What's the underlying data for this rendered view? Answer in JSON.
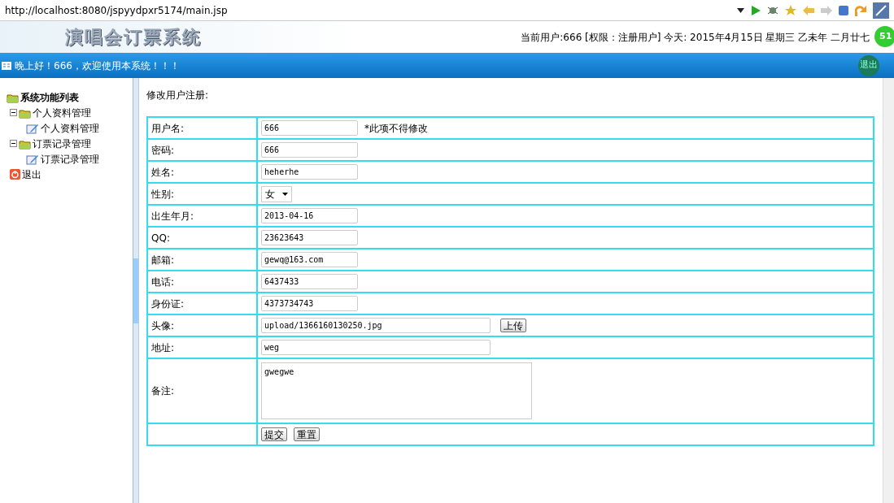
{
  "browser": {
    "url": "http://localhost:8080/jspyydpxr5174/main.jsp"
  },
  "header": {
    "title": "演唱会订票系统",
    "user_info": "当前用户:666 [权限：注册用户] 今天:  2015年4月15日 星期三 乙未年 二月廿七",
    "badge": "51"
  },
  "welcome_bar": {
    "greeting": "晚上好！666，欢迎使用本系统！！！",
    "logout": "退出"
  },
  "sidebar": {
    "title": "系统功能列表",
    "items": [
      {
        "label": "个人资料管理",
        "kind": "folder",
        "expanded": true,
        "children": [
          {
            "label": "个人资料管理",
            "kind": "page"
          }
        ]
      },
      {
        "label": "订票记录管理",
        "kind": "folder",
        "expanded": true,
        "children": [
          {
            "label": "订票记录管理",
            "kind": "page"
          }
        ]
      },
      {
        "label": "退出",
        "kind": "exit"
      }
    ]
  },
  "form": {
    "title": "修改用户注册:",
    "rows": [
      {
        "label": "用户名:",
        "kind": "input",
        "value": "666",
        "note": "*此项不得修改"
      },
      {
        "label": "密码:",
        "kind": "input",
        "value": "666"
      },
      {
        "label": "姓名:",
        "kind": "input",
        "value": "heherhe"
      },
      {
        "label": "性别:",
        "kind": "select",
        "value": "女"
      },
      {
        "label": "出生年月:",
        "kind": "input",
        "value": "2013-04-16"
      },
      {
        "label": "QQ:",
        "kind": "input",
        "value": "23623643"
      },
      {
        "label": "邮箱:",
        "kind": "input",
        "value": "gewq@163.com"
      },
      {
        "label": "电话:",
        "kind": "input",
        "value": "6437433"
      },
      {
        "label": "身份证:",
        "kind": "input",
        "value": "4373734743"
      },
      {
        "label": "头像:",
        "kind": "long_input",
        "value": "upload/1366160130250.jpg",
        "button": "上传"
      },
      {
        "label": "地址:",
        "kind": "long_input",
        "value": "weg"
      },
      {
        "label": "备注:",
        "kind": "textarea",
        "value": "gwegwe"
      }
    ],
    "buttons": [
      "提交",
      "重置"
    ]
  }
}
